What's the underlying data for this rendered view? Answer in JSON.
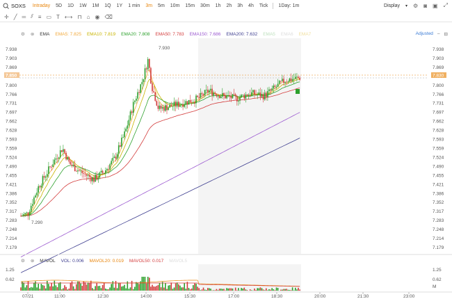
{
  "symbol": "SOXS",
  "timeframes": [
    "Intraday",
    "5D",
    "1D",
    "1W",
    "1M",
    "1Q",
    "1Y",
    "1 min",
    "3m",
    "5m",
    "10m",
    "15m",
    "30m",
    "1h",
    "2h",
    "3h",
    "4h",
    "Tick",
    "1Day: 1m"
  ],
  "active_timeframe": "Intraday",
  "highlight_timeframe": "3m",
  "display_label": "Display",
  "adjusted_label": "Adjusted",
  "main_legend": {
    "ema": "EMA",
    "ema5": "EMA5: 7.825",
    "ema10": "EMA10: 7.819",
    "ema20": "EMA20: 7.808",
    "ema50": "EMA50: 7.783",
    "ema150": "EMA150: 7.686",
    "ema200": "EMA200: 7.632",
    "emaX": "EMA5",
    "emaY": "EMA6",
    "emaZ": "EMA7"
  },
  "vol_legend": {
    "mavol": "MAVOL",
    "vol": "VOL: 0.006",
    "mavol20": "MAVOL20: 0.019",
    "mavol50": "MAVOL50: 0.017",
    "extra": "MAVOL5"
  },
  "colors": {
    "ema5": "#f2a93b",
    "ema10": "#c8b400",
    "ema20": "#2ca02c",
    "ema50": "#d33c3c",
    "ema150": "#9b59d0",
    "ema200": "#3d3d8f",
    "up": "#2ca02c",
    "down": "#d23c3c",
    "accent": "#e8850c",
    "link": "#3a7bd5"
  },
  "price_axis": [
    "7.938",
    "7.903",
    "7.869",
    "7.834",
    "7.800",
    "7.766",
    "7.731",
    "7.697",
    "7.662",
    "7.628",
    "7.593",
    "7.559",
    "7.524",
    "7.490",
    "7.455",
    "7.421",
    "7.386",
    "7.352",
    "7.317",
    "7.283",
    "7.248",
    "7.214",
    "7.179"
  ],
  "left_axis": [
    "7.938",
    "7.903",
    "7.869",
    "7.850",
    "7.800",
    "7.766",
    "7.731",
    "7.697",
    "7.662",
    "7.628",
    "7.593",
    "7.559",
    "7.524",
    "7.490",
    "7.455",
    "7.421",
    "7.386",
    "7.352",
    "7.317",
    "7.283",
    "7.248",
    "7.214",
    "7.179"
  ],
  "current_price": "7.830",
  "left_ref_price": "7.850",
  "high_label": "7.930",
  "low_label": "7.290",
  "vol_axis": [
    "1.25",
    "0.62",
    "M"
  ],
  "time_axis": [
    "07/21",
    "11:00",
    "12:30",
    "14:00",
    "15:30",
    "17:00",
    "18:30",
    "20:00",
    "21:30",
    "23:00"
  ],
  "chart_data": {
    "type": "candlestick",
    "series_lines": [
      "EMA5",
      "EMA10",
      "EMA20",
      "EMA50",
      "EMA150",
      "EMA200"
    ],
    "y_range": [
      7.179,
      7.938
    ],
    "last": 7.83,
    "high": 7.93,
    "low": 7.29
  }
}
